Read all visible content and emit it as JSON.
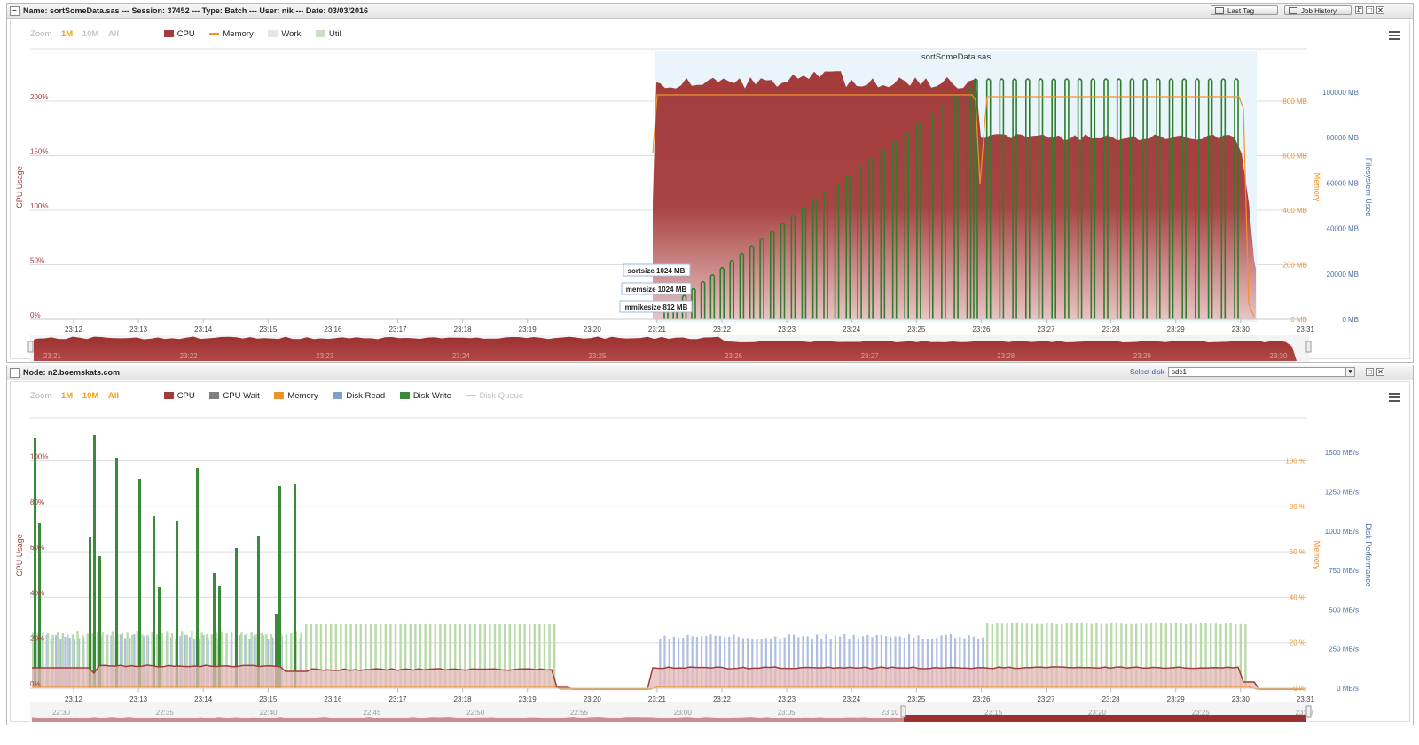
{
  "job_panel": {
    "title": "Name: sortSomeData.sas --- Session: 37452 --- Type: Batch --- User: nik --- Date: 03/03/2016",
    "last_tag_label": "Last Tag",
    "job_history_label": "Job History",
    "zoom_label": "Zoom",
    "zoom_options": [
      "1M",
      "10M",
      "All"
    ],
    "legend": [
      "CPU",
      "Memory",
      "Work",
      "Util"
    ],
    "job_name": "sortSomeData.sas",
    "y_left_title": "CPU Usage",
    "y_left_ticks": [
      "0%",
      "50%",
      "100%",
      "150%",
      "200%"
    ],
    "y_mid_title": "Memory",
    "y_mid_ticks": [
      "0 MB",
      "200 MB",
      "400 MB",
      "600 MB",
      "800 MB"
    ],
    "y_right_title": "Filesystem Used",
    "y_right_ticks": [
      "0 MB",
      "20000 MB",
      "40000 MB",
      "60000 MB",
      "80000 MB",
      "100000 MB"
    ],
    "x_ticks": [
      "23:12",
      "23:13",
      "23:14",
      "23:15",
      "23:16",
      "23:17",
      "23:18",
      "23:19",
      "23:20",
      "23:21",
      "23:22",
      "23:23",
      "23:24",
      "23:25",
      "23:26",
      "23:27",
      "23:28",
      "23:29",
      "23:30",
      "23:31"
    ],
    "nav_ticks": [
      "23:21",
      "23:22",
      "23:23",
      "23:24",
      "23:25",
      "23:26",
      "23:27",
      "23:28",
      "23:29",
      "23:30"
    ],
    "annotations": [
      "sortsize 1024 MB",
      "memsize 1024 MB",
      "mmikesize 812 MB"
    ]
  },
  "node_panel": {
    "title": "Node: n2.boemskats.com",
    "select_disk_label": "Select disk",
    "select_disk_value": "sdc1",
    "zoom_label": "Zoom",
    "zoom_options": [
      "1M",
      "10M",
      "All"
    ],
    "legend": [
      "CPU",
      "CPU Wait",
      "Memory",
      "Disk Read",
      "Disk Write",
      "Disk Queue"
    ],
    "y_left_title": "CPU Usage",
    "y_left_ticks": [
      "0%",
      "20%",
      "40%",
      "60%",
      "80%",
      "100%"
    ],
    "y_mid_title": "Memory",
    "y_mid_ticks": [
      "0 %",
      "20 %",
      "40 %",
      "60 %",
      "80 %",
      "100 %"
    ],
    "y_right_title": "Disk Performance",
    "y_right_ticks": [
      "0 MB/s",
      "250 MB/s",
      "500 MB/s",
      "750 MB/s",
      "1000 MB/s",
      "1250 MB/s",
      "1500 MB/s"
    ],
    "x_ticks": [
      "23:12",
      "23:13",
      "23:14",
      "23:15",
      "23:16",
      "23:17",
      "23:18",
      "23:19",
      "23:20",
      "23:21",
      "23:22",
      "23:23",
      "23:24",
      "23:25",
      "23:26",
      "23:27",
      "23:28",
      "23:29",
      "23:30",
      "23:31"
    ],
    "nav_ticks": [
      "22:30",
      "22:35",
      "22:40",
      "22:45",
      "22:50",
      "22:55",
      "23:00",
      "23:05",
      "23:10",
      "23:15",
      "23:20",
      "23:25",
      "23:30"
    ]
  },
  "colors": {
    "cpu": "#a33b3b",
    "memory": "#f0922b",
    "work": "#e4e6ea",
    "util": "#c9e0c0",
    "cpu_wait": "#808080",
    "disk_read": "#7f9fcf",
    "disk_write": "#3a8a3a",
    "disk_queue": "#c8c8c8",
    "link": "#f0a020",
    "job_band": "#e9f5fb"
  },
  "chart_data": [
    {
      "type": "area",
      "series": [
        {
          "name": "CPU",
          "x": [
            "23:21",
            "23:22",
            "23:23",
            "23:24",
            "23:25",
            "23:26",
            "23:27",
            "23:28",
            "23:29",
            "23:30",
            "23:31"
          ],
          "values": [
            218,
            218,
            220,
            220,
            218,
            170,
            170,
            170,
            170,
            170,
            50
          ]
        },
        {
          "name": "Memory",
          "x": [
            "23:21",
            "23:22",
            "23:23",
            "23:24",
            "23:25",
            "23:26",
            "23:27",
            "23:28",
            "23:29",
            "23:30",
            "23:31"
          ],
          "values": [
            800,
            800,
            800,
            800,
            800,
            800,
            800,
            800,
            800,
            800,
            0
          ]
        }
      ],
      "ylim": [
        0,
        220
      ]
    },
    {
      "type": "bar",
      "series": [
        {
          "name": "CPU",
          "x": [
            "23:12",
            "23:13",
            "23:14",
            "23:15",
            "23:16",
            "23:17",
            "23:18",
            "23:19",
            "23:20",
            "23:21",
            "23:22",
            "23:23",
            "23:24",
            "23:25",
            "23:26",
            "23:27",
            "23:28",
            "23:29",
            "23:30",
            "23:31"
          ],
          "values": [
            10,
            10,
            10,
            10,
            8,
            8,
            8,
            8,
            0,
            10,
            10,
            10,
            10,
            10,
            10,
            10,
            10,
            10,
            0,
            0
          ]
        },
        {
          "name": "Disk Write",
          "x": [
            "23:12",
            "23:13",
            "23:14",
            "23:15",
            "23:16"
          ],
          "values": [
            1450,
            1050,
            1100,
            900,
            280
          ]
        }
      ]
    }
  ]
}
